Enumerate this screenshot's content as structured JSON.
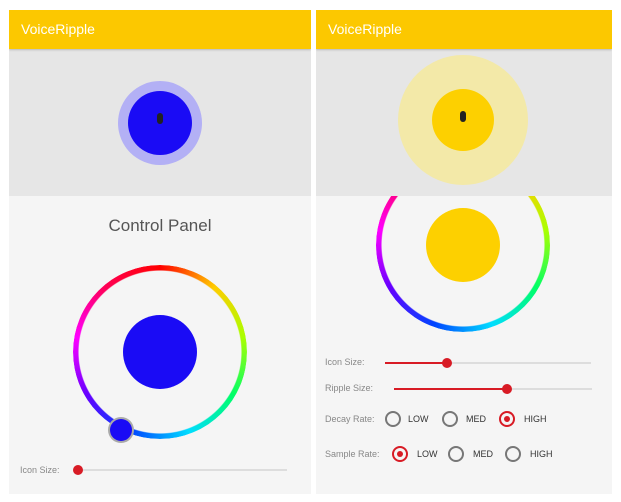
{
  "app_title": "VoiceRipple",
  "left": {
    "ripple_color": "#1a0bf5",
    "panel_title": "Control Panel",
    "icon_size_label": "Icon Size:",
    "icon_size_value": 0
  },
  "right": {
    "ripple_color": "#fdd000",
    "icon_size_label": "Icon Size:",
    "icon_size_value": 0.3,
    "ripple_size_label": "Ripple Size:",
    "ripple_size_value": 0.57,
    "decay_rate": {
      "label": "Decay Rate:",
      "options": [
        "LOW",
        "MED",
        "HIGH"
      ],
      "selected": "HIGH"
    },
    "sample_rate": {
      "label": "Sample Rate:",
      "options": [
        "LOW",
        "MED",
        "HIGH"
      ],
      "selected": "LOW"
    }
  }
}
